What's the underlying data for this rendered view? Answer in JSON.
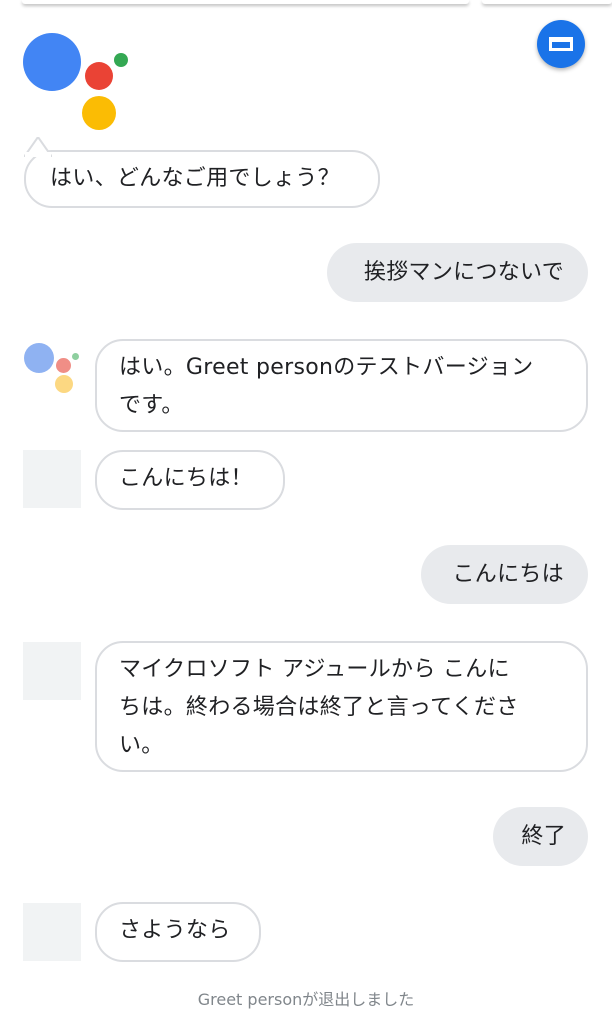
{
  "header": {
    "keyboard_button_icon": "keyboard-icon"
  },
  "conversation": {
    "assistant_greeting": "はい、どんなご用でしょう？",
    "user_msg_1": "挨拶マンにつないで",
    "bot_msg_1_line1": "はい。Greet personのテストバージョン",
    "bot_msg_1_line2": "です。",
    "bot_msg_2": "こんにちは！",
    "user_msg_2": "こんにちは",
    "bot_msg_3_line1": "マイクロソフト アジュールから こんに",
    "bot_msg_3_line2": "ちは。終わる場合は終了と言ってくださ",
    "bot_msg_3_line3": "い。",
    "user_msg_3": "終了",
    "bot_msg_4": "さようなら"
  },
  "footer": {
    "status": "Greet personが退出しました"
  },
  "colors": {
    "google_blue": "#4285f4",
    "google_red": "#ea4335",
    "google_yellow": "#fbbc04",
    "google_green": "#34a853",
    "accent": "#1a73e8"
  }
}
